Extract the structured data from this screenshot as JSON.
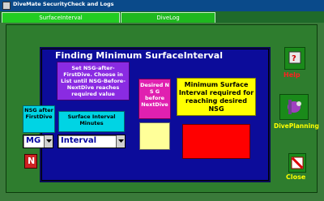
{
  "window": {
    "title": "DiveMate SecurityCheck and Logs"
  },
  "tabs": [
    {
      "label": "SurfaceInterval",
      "active": true
    },
    {
      "label": "DiveLog",
      "active": false
    }
  ],
  "main": {
    "heading": "Finding Minimum SurfaceInterval",
    "instruction": "Set NSG-after-FirstDive. Choose in List until NSG-Before-NextDive reaches required value",
    "desired_label": "Desired N S G before NextDive",
    "minimum_label": "Minimum Surface Interval  required for reaching desired NSG",
    "nsg_after_label": "NSG after FirstDive",
    "surface_interval_label": "Surface Interval Minutes",
    "nsg_select_value": "MG",
    "interval_select_value": "Interval",
    "n_button_label": "N"
  },
  "side": {
    "help_label": "Help",
    "diveplanning_label": "DivePlanning",
    "close_label": "Close"
  },
  "colors": {
    "screen": "#0c0c9a",
    "instruction_bg": "#8a2be2",
    "desired_bg": "#e020b0",
    "minimum_bg": "#ffff00",
    "label_cyan": "#00d4e4",
    "result_red": "#ff0000",
    "desired_output": "#ffff99"
  }
}
